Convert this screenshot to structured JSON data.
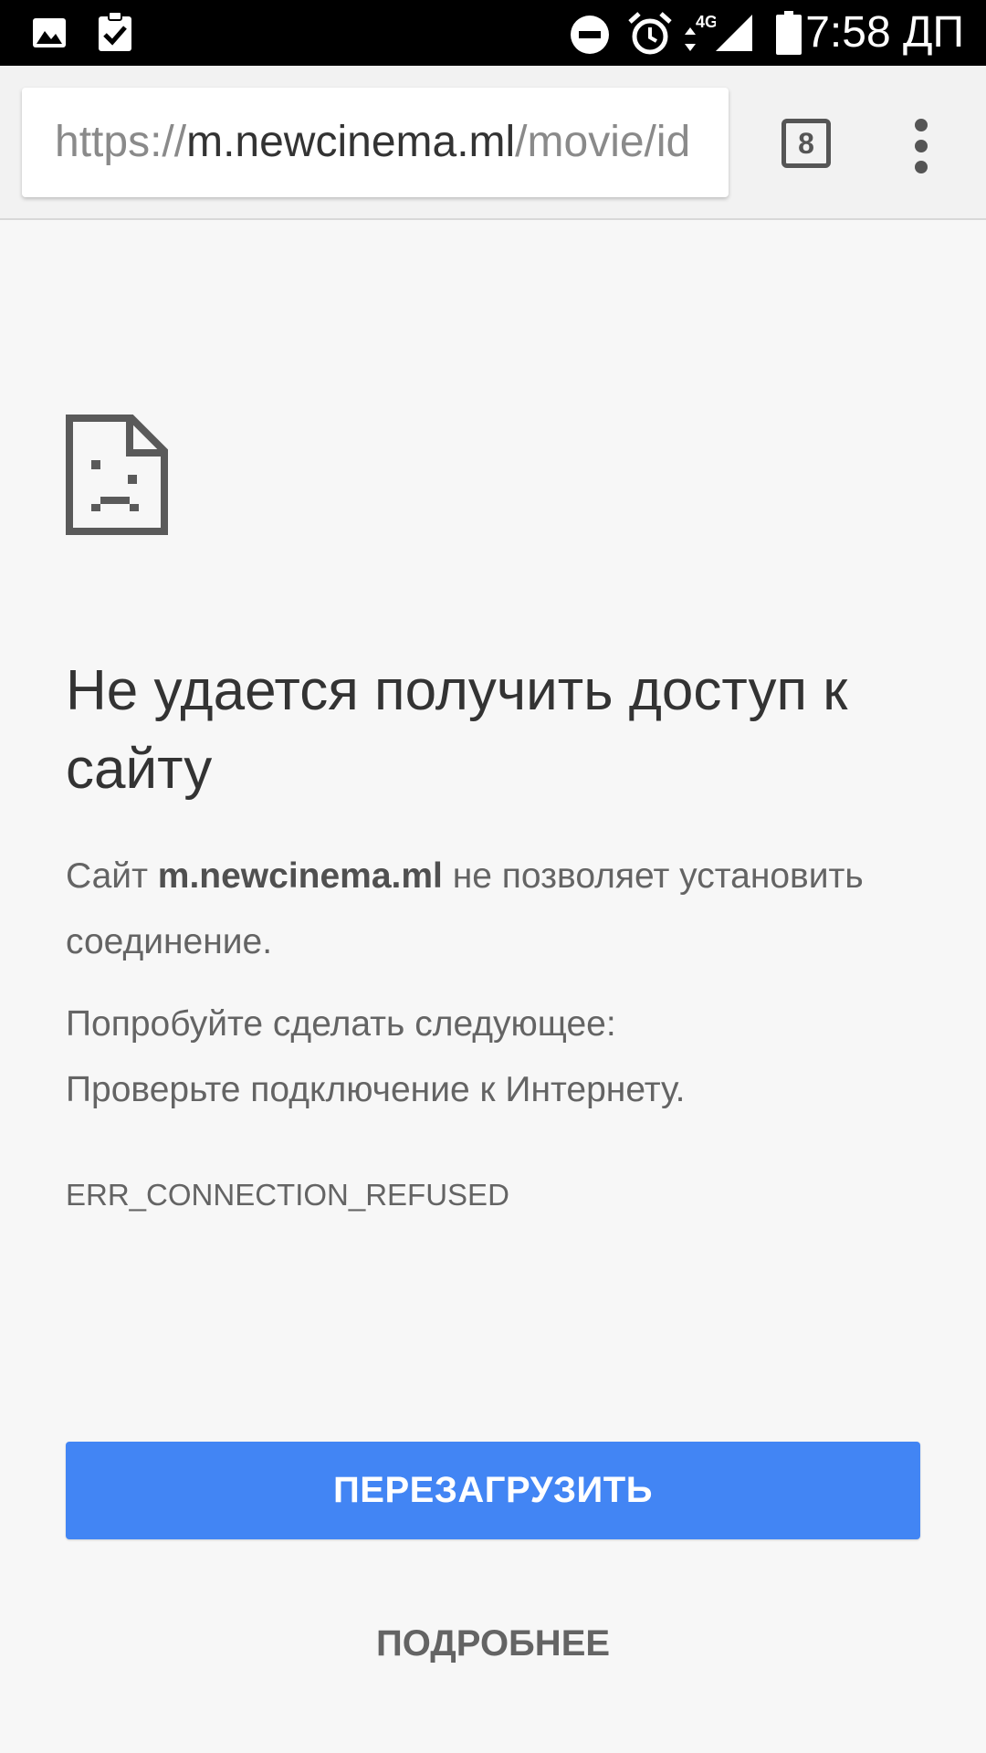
{
  "status_bar": {
    "time": "7:58 ДП",
    "network": "4G",
    "left_icons": [
      "image-icon",
      "clipboard-check-icon"
    ],
    "right_icons": [
      "do-not-disturb-icon",
      "alarm-icon",
      "network-4g-icon",
      "signal-icon",
      "battery-icon"
    ]
  },
  "toolbar": {
    "url_scheme": "https://",
    "url_host": "m.newcinema.ml",
    "url_path": "/movie/id",
    "tab_count": "8"
  },
  "error": {
    "headline": "Не удается получить доступ к сайту",
    "desc_prefix": "Сайт ",
    "desc_host": "m.newcinema.ml",
    "desc_suffix": " не позволяет установить соединение.",
    "suggestions_title": "Попробуйте сделать следующее:",
    "suggestion_1": "Проверьте подключение к Интернету.",
    "code": "ERR_CONNECTION_REFUSED"
  },
  "buttons": {
    "reload_label": "ПЕРЕЗАГРУЗИТЬ",
    "details_label": "ПОДРОБНЕЕ"
  },
  "colors": {
    "accent": "#4285f4",
    "status_bar": "#000000",
    "background": "#f7f7f7"
  }
}
